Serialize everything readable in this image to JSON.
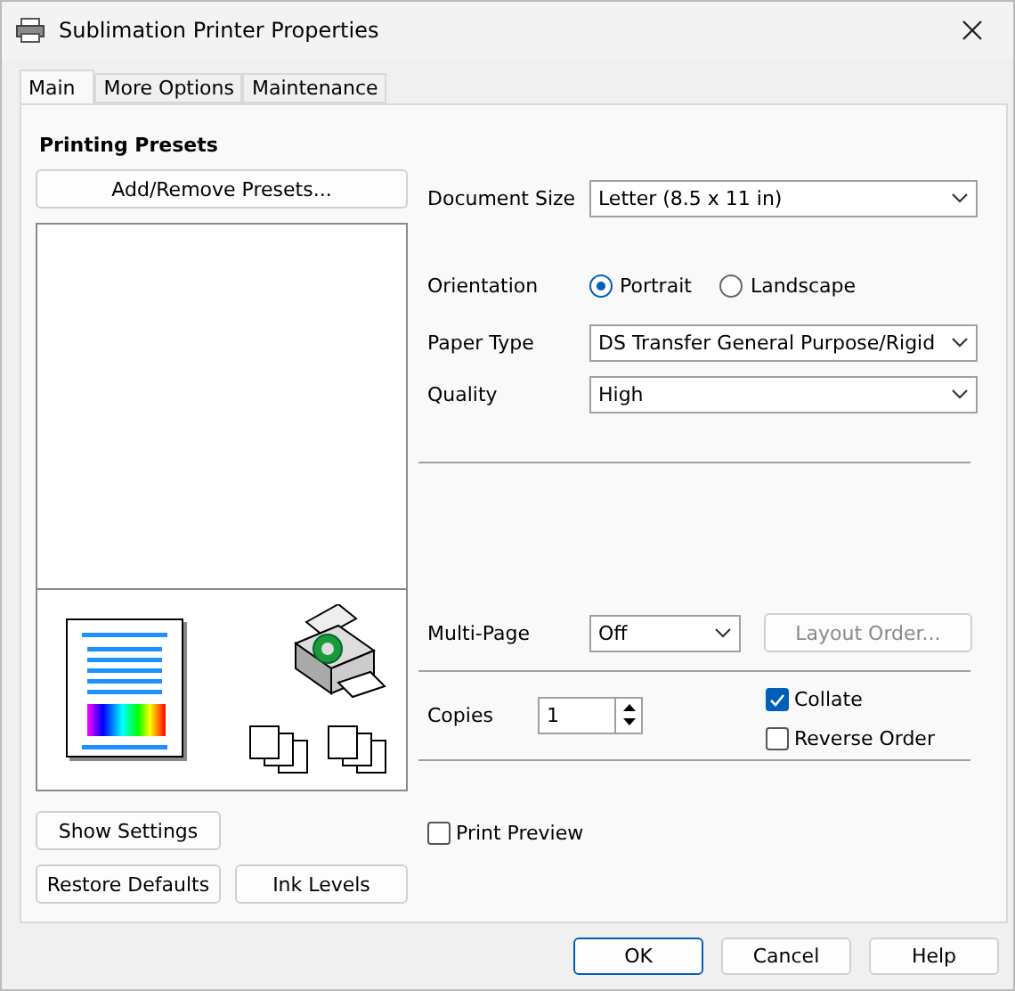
{
  "window": {
    "title": "Sublimation Printer Properties"
  },
  "tabs": [
    {
      "label": "Main",
      "selected": true
    },
    {
      "label": "More Options",
      "selected": false
    },
    {
      "label": "Maintenance",
      "selected": false
    }
  ],
  "presets": {
    "heading": "Printing Presets",
    "button": "Add/Remove Presets..."
  },
  "left_buttons": {
    "show_settings": "Show Settings",
    "restore_defaults": "Restore Defaults",
    "ink_levels": "Ink Levels"
  },
  "document_size": {
    "label": "Document Size",
    "value": "Letter (8.5 x 11 in)"
  },
  "orientation": {
    "label": "Orientation",
    "options": [
      {
        "label": "Portrait",
        "selected": true
      },
      {
        "label": "Landscape",
        "selected": false
      }
    ]
  },
  "paper_type": {
    "label": "Paper Type",
    "value": "DS Transfer General Purpose/Rigid"
  },
  "quality": {
    "label": "Quality",
    "value": "High"
  },
  "multi_page": {
    "label": "Multi-Page",
    "value": "Off",
    "button": {
      "label": "Layout Order...",
      "disabled": true
    }
  },
  "copies": {
    "label": "Copies",
    "value": "1"
  },
  "collate": {
    "label": "Collate",
    "checked": true
  },
  "reverse_order": {
    "label": "Reverse Order",
    "checked": false
  },
  "print_preview": {
    "label": "Print Preview",
    "checked": false
  },
  "footer_buttons": [
    {
      "label": "OK",
      "default": true
    },
    {
      "label": "Cancel",
      "default": false
    },
    {
      "label": "Help",
      "default": false
    }
  ]
}
